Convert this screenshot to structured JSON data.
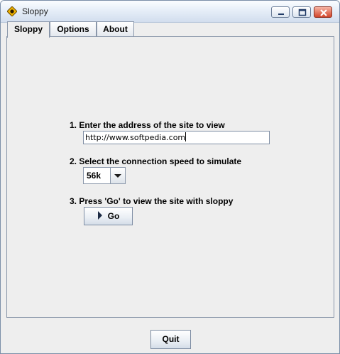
{
  "window": {
    "title": "Sloppy",
    "icon": "sloppy-app-icon",
    "controls": [
      "minimize-icon",
      "maximize-icon",
      "close-icon"
    ]
  },
  "tabs": [
    {
      "label": "Sloppy",
      "active": true
    },
    {
      "label": "Options",
      "active": false
    },
    {
      "label": "About",
      "active": false
    }
  ],
  "form": {
    "step1_label": "1. Enter the address of the site to view",
    "url_value": "http://www.softpedia.com",
    "step2_label": "2. Select the connection speed to simulate",
    "speed_value": "56k",
    "step3_label": "3. Press 'Go' to view the site with sloppy",
    "go_label": "Go"
  },
  "footer": {
    "quit_label": "Quit"
  }
}
